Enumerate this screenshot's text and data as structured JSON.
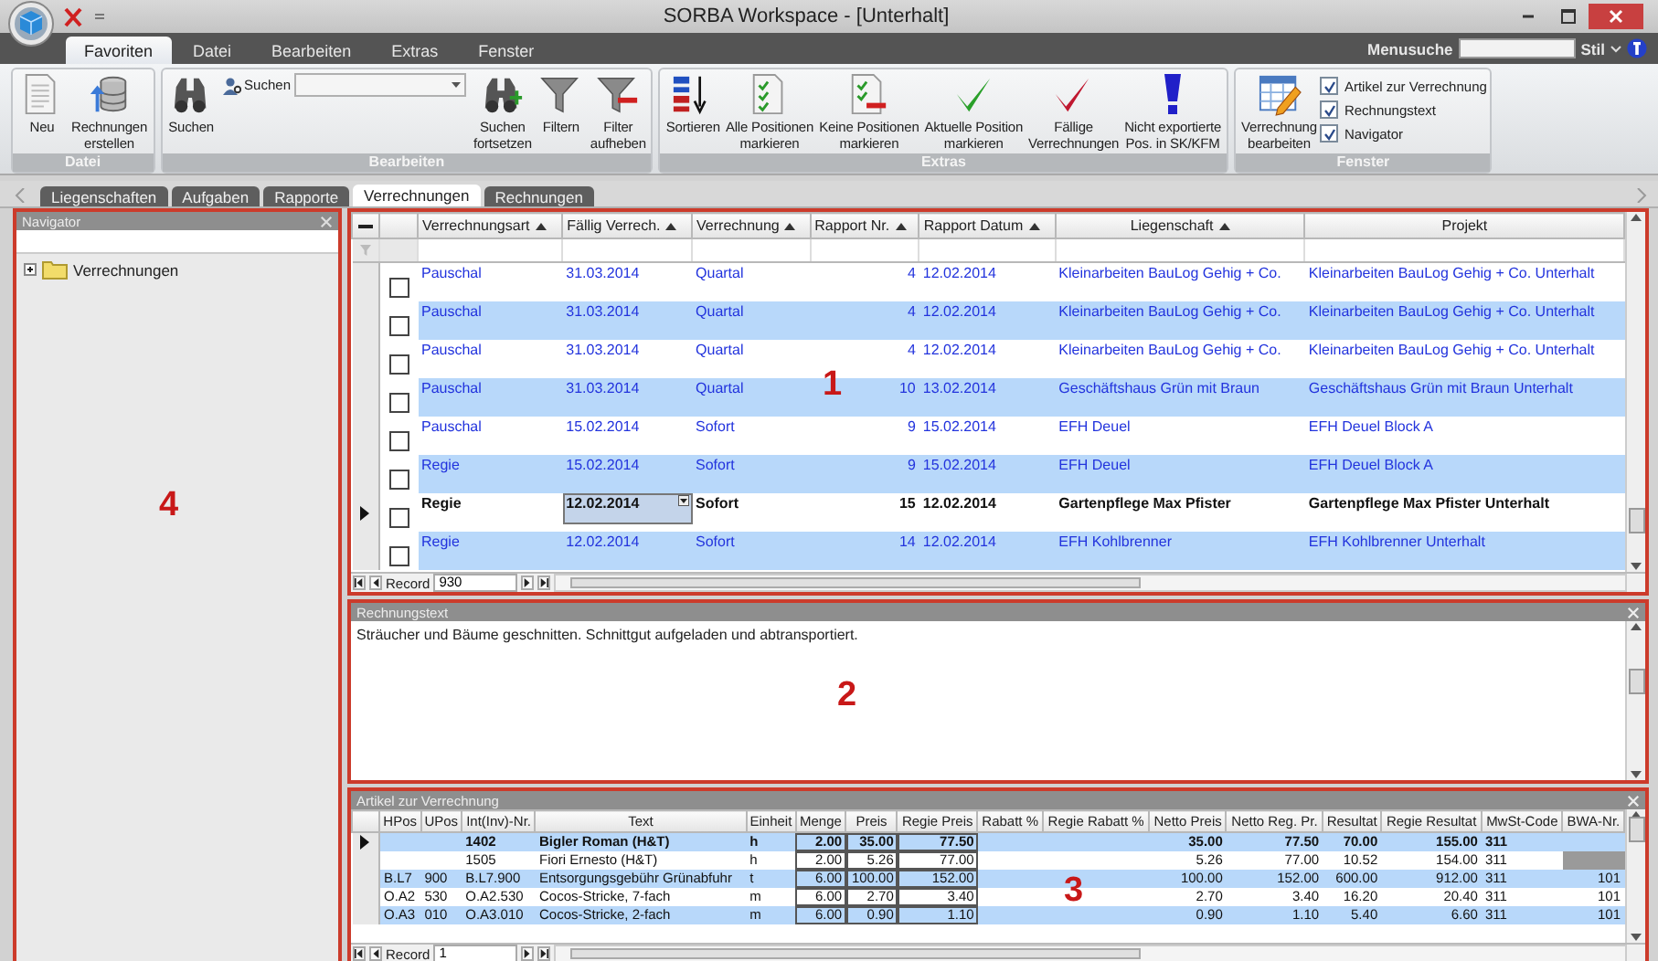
{
  "window": {
    "title": "SORBA Workspace - [Unterhalt]"
  },
  "ribbon": {
    "tabs": [
      {
        "label": "Favoriten",
        "selected": true
      },
      {
        "label": "Datei",
        "selected": false
      },
      {
        "label": "Bearbeiten",
        "selected": false
      },
      {
        "label": "Extras",
        "selected": false
      },
      {
        "label": "Fenster",
        "selected": false
      }
    ],
    "menu_search_label": "Menusuche",
    "style_label": "Stil",
    "groups": [
      {
        "caption": "Datei",
        "items": [
          {
            "kind": "button",
            "lines": [
              "Neu"
            ]
          },
          {
            "kind": "button",
            "lines": [
              "Rechnungen",
              "erstellen"
            ]
          }
        ]
      },
      {
        "caption": "Bearbeiten",
        "items": [
          {
            "kind": "button",
            "lines": [
              "Suchen"
            ]
          },
          {
            "kind": "search",
            "label": "Suchen"
          },
          {
            "kind": "button",
            "lines": [
              "Suchen",
              "fortsetzen"
            ]
          },
          {
            "kind": "button",
            "lines": [
              "Filtern"
            ]
          },
          {
            "kind": "button",
            "lines": [
              "Filter",
              "aufheben"
            ]
          }
        ]
      },
      {
        "caption": "Extras",
        "items": [
          {
            "kind": "button",
            "lines": [
              "Sortieren"
            ]
          },
          {
            "kind": "button",
            "lines": [
              "Alle Positionen",
              "markieren"
            ]
          },
          {
            "kind": "button",
            "lines": [
              "Keine Positionen",
              "markieren"
            ]
          },
          {
            "kind": "button",
            "lines": [
              "Aktuelle Position",
              "markieren"
            ]
          },
          {
            "kind": "button",
            "lines": [
              "Fällige",
              "Verrechnungen"
            ]
          },
          {
            "kind": "button",
            "lines": [
              "Nicht exportierte",
              "Pos. in SK/KFM"
            ]
          }
        ]
      },
      {
        "caption": "Fenster",
        "items": [
          {
            "kind": "button",
            "lines": [
              "Verrechnung",
              "bearbeiten"
            ]
          },
          {
            "kind": "checkbox",
            "label": "Artikel zur Verrechnung",
            "checked": true
          },
          {
            "kind": "checkbox",
            "label": "Rechnungstext",
            "checked": true
          },
          {
            "kind": "checkbox",
            "label": "Navigator",
            "checked": true
          }
        ]
      }
    ]
  },
  "document_tabs": [
    {
      "label": "Liegenschaften",
      "selected": false
    },
    {
      "label": "Aufgaben",
      "selected": false
    },
    {
      "label": "Rapporte",
      "selected": false
    },
    {
      "label": "Verrechnungen",
      "selected": true
    },
    {
      "label": "Rechnungen",
      "selected": false
    }
  ],
  "navigator": {
    "title": "Navigator",
    "annotation": "4",
    "tree": [
      {
        "label": "Verrechnungen",
        "expanded": false
      }
    ]
  },
  "billing_grid": {
    "annotation": "1",
    "columns": [
      {
        "label": "Verrechnungsart",
        "sorted": true
      },
      {
        "label": "Fällig Verrech.",
        "sorted": true
      },
      {
        "label": "Verrechnung",
        "sorted": true
      },
      {
        "label": "Rapport Nr.",
        "sorted": true
      },
      {
        "label": "Rapport Datum",
        "sorted": true
      },
      {
        "label": "Liegenschaft",
        "sorted": true
      },
      {
        "label": "Projekt",
        "sorted": false
      }
    ],
    "rows": [
      {
        "selected": false,
        "checked": false,
        "cells": [
          "Pauschal",
          "31.03.2014",
          "Quartal",
          "4",
          "12.02.2014",
          "Kleinarbeiten BauLog Gehig + Co.",
          "Kleinarbeiten BauLog Gehig + Co. Unterhalt"
        ]
      },
      {
        "selected": false,
        "checked": false,
        "cells": [
          "Pauschal",
          "31.03.2014",
          "Quartal",
          "4",
          "12.02.2014",
          "Kleinarbeiten BauLog Gehig + Co.",
          "Kleinarbeiten BauLog Gehig + Co. Unterhalt"
        ]
      },
      {
        "selected": false,
        "checked": false,
        "cells": [
          "Pauschal",
          "31.03.2014",
          "Quartal",
          "4",
          "12.02.2014",
          "Kleinarbeiten BauLog Gehig + Co.",
          "Kleinarbeiten BauLog Gehig + Co. Unterhalt"
        ]
      },
      {
        "selected": false,
        "checked": false,
        "cells": [
          "Pauschal",
          "31.03.2014",
          "Quartal",
          "10",
          "13.02.2014",
          "Geschäftshaus Grün mit Braun",
          "Geschäftshaus Grün mit Braun Unterhalt"
        ]
      },
      {
        "selected": false,
        "checked": false,
        "cells": [
          "Pauschal",
          "15.02.2014",
          "Sofort",
          "9",
          "15.02.2014",
          "EFH Deuel",
          "EFH Deuel Block A"
        ]
      },
      {
        "selected": false,
        "checked": false,
        "cells": [
          "Regie",
          "15.02.2014",
          "Sofort",
          "9",
          "15.02.2014",
          "EFH Deuel",
          "EFH Deuel Block A"
        ]
      },
      {
        "selected": true,
        "checked": false,
        "cells": [
          "Regie",
          {
            "text": "12.02.2014",
            "editing": true
          },
          "Sofort",
          "15",
          "12.02.2014",
          "Gartenpflege Max Pfister",
          "Gartenpflege Max Pfister Unterhalt"
        ]
      },
      {
        "selected": false,
        "checked": false,
        "cells": [
          "Regie",
          "12.02.2014",
          "Sofort",
          "14",
          "12.02.2014",
          "EFH Kohlbrenner",
          "EFH Kohlbrenner Unterhalt"
        ]
      }
    ],
    "record_label": "Record",
    "record": "930"
  },
  "invoice_text": {
    "title": "Rechnungstext",
    "annotation": "2",
    "text": "Sträucher und Bäume geschnitten. Schnittgut aufgeladen und abtransportiert."
  },
  "articles": {
    "title": "Artikel zur Verrechnung",
    "annotation": "3",
    "columns": [
      "HPos",
      "UPos",
      "Int(Inv)-Nr.",
      "Text",
      "Einheit",
      "Menge",
      "Preis",
      "Regie Preis",
      "Rabatt %",
      "Regie Rabatt %",
      "Netto Preis",
      "Netto Reg. Pr.",
      "Resultat",
      "Regie Resultat",
      "MwSt-Code",
      "BWA-Nr."
    ],
    "rows": [
      {
        "selected": true,
        "cells": [
          null,
          null,
          "1402",
          "Bigler Roman (H&T)",
          "h",
          "2.00",
          "35.00",
          "77.50",
          null,
          null,
          "35.00",
          "77.50",
          "70.00",
          "155.00",
          "311",
          null
        ]
      },
      {
        "selected": false,
        "cells": [
          null,
          null,
          "1505",
          "Fiori Ernesto (H&T)",
          "h",
          "2.00",
          "5.26",
          "77.00",
          null,
          null,
          "5.26",
          "77.00",
          "10.52",
          "154.00",
          "311",
          null
        ]
      },
      {
        "selected": false,
        "cells": [
          "B.L7",
          "900",
          "B.L7.900",
          "Entsorgungsgebühr Grünabfuhr",
          "t",
          "6.00",
          "100.00",
          "152.00",
          null,
          null,
          "100.00",
          "152.00",
          "600.00",
          "912.00",
          "311",
          "101"
        ]
      },
      {
        "selected": false,
        "cells": [
          "O.A2",
          "530",
          "O.A2.530",
          "Cocos-Stricke, 7-fach",
          "m",
          "6.00",
          "2.70",
          "3.40",
          null,
          null,
          "2.70",
          "3.40",
          "16.20",
          "20.40",
          "311",
          "101"
        ]
      },
      {
        "selected": false,
        "cells": [
          "O.A3",
          "010",
          "O.A3.010",
          "Cocos-Stricke, 2-fach",
          "m",
          "6.00",
          "0.90",
          "1.10",
          null,
          null,
          "0.90",
          "1.10",
          "5.40",
          "6.60",
          "311",
          "101"
        ]
      }
    ],
    "record_label": "Record",
    "record": "1"
  }
}
